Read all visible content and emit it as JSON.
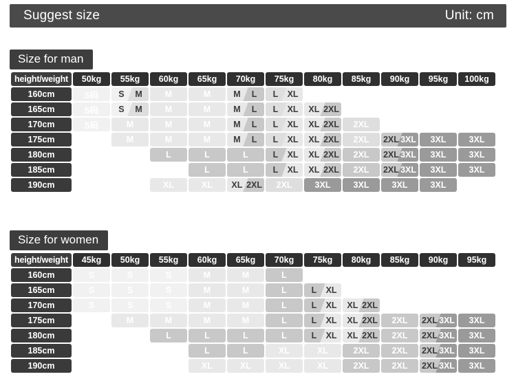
{
  "banner": {
    "title": "Suggest size",
    "unit": "Unit: cm"
  },
  "men": {
    "tab_label": "Size for man",
    "corner_label": "height/weight",
    "weights": [
      "50kg",
      "55kg",
      "60kg",
      "65kg",
      "70kg",
      "75kg",
      "80kg",
      "85kg",
      "90kg",
      "95kg",
      "100kg"
    ],
    "heights": [
      "160cm",
      "165cm",
      "170cm",
      "175cm",
      "180cm",
      "185cm",
      "190cm"
    ],
    "rows": [
      [
        {
          "t": "S码",
          "tone": 1
        },
        {
          "t": "S",
          "t2": "M",
          "tone": 1,
          "tone2": 3
        },
        {
          "t": "M",
          "tone": 2
        },
        {
          "t": "M",
          "tone": 2
        },
        {
          "t": "M",
          "t2": "L",
          "tone": 2,
          "tone2": 4
        },
        {
          "t": "L",
          "t2": "XL",
          "tone": 3,
          "tone2": 2
        },
        {
          "t": "",
          "tone": 0
        },
        {
          "t": "",
          "tone": 0
        },
        {
          "t": "",
          "tone": 0
        },
        {
          "t": "",
          "tone": 0
        },
        {
          "t": "",
          "tone": 0
        }
      ],
      [
        {
          "t": "S码",
          "tone": 1
        },
        {
          "t": "S",
          "t2": "M",
          "tone": 1,
          "tone2": 3
        },
        {
          "t": "M",
          "tone": 2
        },
        {
          "t": "M",
          "tone": 2
        },
        {
          "t": "M",
          "t2": "L",
          "tone": 2,
          "tone2": 4
        },
        {
          "t": "L",
          "t2": "XL",
          "tone": 3,
          "tone2": 2
        },
        {
          "t": "XL",
          "t2": "2XL",
          "tone": 2,
          "tone2": 4
        },
        {
          "t": "",
          "tone": 0
        },
        {
          "t": "",
          "tone": 0
        },
        {
          "t": "",
          "tone": 0
        },
        {
          "t": "",
          "tone": 0
        }
      ],
      [
        {
          "t": "S码",
          "tone": 1
        },
        {
          "t": "M",
          "tone": 2
        },
        {
          "t": "M",
          "tone": 2
        },
        {
          "t": "M",
          "tone": 2
        },
        {
          "t": "M",
          "t2": "L",
          "tone": 2,
          "tone2": 4
        },
        {
          "t": "L",
          "t2": "XL",
          "tone": 3,
          "tone2": 2
        },
        {
          "t": "XL",
          "t2": "2XL",
          "tone": 2,
          "tone2": 4
        },
        {
          "t": "2XL",
          "tone": 3
        },
        {
          "t": "",
          "tone": 0
        },
        {
          "t": "",
          "tone": 0
        },
        {
          "t": "",
          "tone": 0
        }
      ],
      [
        {
          "t": "",
          "tone": 0
        },
        {
          "t": "M",
          "tone": 2
        },
        {
          "t": "M",
          "tone": 2
        },
        {
          "t": "M",
          "tone": 2
        },
        {
          "t": "M",
          "t2": "L",
          "tone": 2,
          "tone2": 4
        },
        {
          "t": "L",
          "t2": "XL",
          "tone": 3,
          "tone2": 2
        },
        {
          "t": "XL",
          "t2": "2XL",
          "tone": 2,
          "tone2": 4
        },
        {
          "t": "2XL",
          "tone": 3
        },
        {
          "t": "2XL",
          "t2": "3XL",
          "tone": 4,
          "tone2": 6
        },
        {
          "t": "3XL",
          "tone": 6
        },
        {
          "t": "3XL",
          "tone": 6
        }
      ],
      [
        {
          "t": "",
          "tone": 0
        },
        {
          "t": "",
          "tone": 0
        },
        {
          "t": "L",
          "tone": 4
        },
        {
          "t": "L",
          "tone": 4
        },
        {
          "t": "L",
          "tone": 4
        },
        {
          "t": "L",
          "t2": "XL",
          "tone": 4,
          "tone2": 2
        },
        {
          "t": "XL",
          "t2": "2XL",
          "tone": 2,
          "tone2": 4
        },
        {
          "t": "2XL",
          "tone": 4
        },
        {
          "t": "2XL",
          "t2": "3XL",
          "tone": 4,
          "tone2": 6
        },
        {
          "t": "3XL",
          "tone": 6
        },
        {
          "t": "3XL",
          "tone": 6
        }
      ],
      [
        {
          "t": "",
          "tone": 0
        },
        {
          "t": "",
          "tone": 0
        },
        {
          "t": "",
          "tone": 0
        },
        {
          "t": "L",
          "tone": 4
        },
        {
          "t": "L",
          "tone": 4
        },
        {
          "t": "L",
          "t2": "XL",
          "tone": 4,
          "tone2": 2
        },
        {
          "t": "XL",
          "t2": "2XL",
          "tone": 2,
          "tone2": 4
        },
        {
          "t": "2XL",
          "tone": 4
        },
        {
          "t": "2XL",
          "t2": "3XL",
          "tone": 4,
          "tone2": 6
        },
        {
          "t": "3XL",
          "tone": 6
        },
        {
          "t": "3XL",
          "tone": 6
        }
      ],
      [
        {
          "t": "",
          "tone": 0
        },
        {
          "t": "",
          "tone": 0
        },
        {
          "t": "XL",
          "tone": 2
        },
        {
          "t": "XL",
          "tone": 2
        },
        {
          "t": "XL",
          "t2": "2XL",
          "tone": 2,
          "tone2": 4
        },
        {
          "t": "2XL",
          "tone": 3
        },
        {
          "t": "3XL",
          "tone": 6
        },
        {
          "t": "3XL",
          "tone": 6
        },
        {
          "t": "3XL",
          "tone": 6
        },
        {
          "t": "3XL",
          "tone": 6
        },
        {
          "t": "",
          "tone": 0
        }
      ]
    ]
  },
  "women": {
    "tab_label": "Size for women",
    "corner_label": "height/weight",
    "weights": [
      "45kg",
      "50kg",
      "55kg",
      "60kg",
      "65kg",
      "70kg",
      "75kg",
      "80kg",
      "85kg",
      "90kg",
      "95kg"
    ],
    "heights": [
      "160cm",
      "165cm",
      "170cm",
      "175cm",
      "180cm",
      "185cm",
      "190cm"
    ],
    "rows": [
      [
        {
          "t": "S",
          "tone": 1
        },
        {
          "t": "S",
          "tone": 1
        },
        {
          "t": "S",
          "tone": 1
        },
        {
          "t": "M",
          "tone": 2
        },
        {
          "t": "M",
          "tone": 2
        },
        {
          "t": "L",
          "tone": 4
        },
        {
          "t": "",
          "tone": 0
        },
        {
          "t": "",
          "tone": 0
        },
        {
          "t": "",
          "tone": 0
        },
        {
          "t": "",
          "tone": 0
        },
        {
          "t": "",
          "tone": 0
        }
      ],
      [
        {
          "t": "S",
          "tone": 1
        },
        {
          "t": "S",
          "tone": 1
        },
        {
          "t": "S",
          "tone": 1
        },
        {
          "t": "M",
          "tone": 2
        },
        {
          "t": "M",
          "tone": 2
        },
        {
          "t": "L",
          "tone": 4
        },
        {
          "t": "L",
          "t2": "XL",
          "tone": 4,
          "tone2": 2
        },
        {
          "t": "",
          "tone": 0
        },
        {
          "t": "",
          "tone": 0
        },
        {
          "t": "",
          "tone": 0
        },
        {
          "t": "",
          "tone": 0
        }
      ],
      [
        {
          "t": "S",
          "tone": 1
        },
        {
          "t": "S",
          "tone": 1
        },
        {
          "t": "S",
          "tone": 1
        },
        {
          "t": "M",
          "tone": 2
        },
        {
          "t": "M",
          "tone": 2
        },
        {
          "t": "L",
          "tone": 4
        },
        {
          "t": "L",
          "t2": "XL",
          "tone": 4,
          "tone2": 2
        },
        {
          "t": "XL",
          "t2": "2XL",
          "tone": 2,
          "tone2": 4
        },
        {
          "t": "",
          "tone": 0
        },
        {
          "t": "",
          "tone": 0
        },
        {
          "t": "",
          "tone": 0
        }
      ],
      [
        {
          "t": "",
          "tone": 0
        },
        {
          "t": "M",
          "tone": 2
        },
        {
          "t": "M",
          "tone": 2
        },
        {
          "t": "M",
          "tone": 2
        },
        {
          "t": "M",
          "tone": 2
        },
        {
          "t": "L",
          "tone": 4
        },
        {
          "t": "L",
          "t2": "XL",
          "tone": 4,
          "tone2": 2
        },
        {
          "t": "XL",
          "t2": "2XL",
          "tone": 2,
          "tone2": 4
        },
        {
          "t": "2XL",
          "tone": 4
        },
        {
          "t": "2XL",
          "t2": "3XL",
          "tone": 4,
          "tone2": 6
        },
        {
          "t": "3XL",
          "tone": 6
        }
      ],
      [
        {
          "t": "",
          "tone": 0
        },
        {
          "t": "",
          "tone": 0
        },
        {
          "t": "L",
          "tone": 4
        },
        {
          "t": "L",
          "tone": 4
        },
        {
          "t": "L",
          "tone": 4
        },
        {
          "t": "L",
          "tone": 4
        },
        {
          "t": "L",
          "t2": "XL",
          "tone": 4,
          "tone2": 2
        },
        {
          "t": "XL",
          "t2": "2XL",
          "tone": 2,
          "tone2": 4
        },
        {
          "t": "2XL",
          "tone": 4
        },
        {
          "t": "2XL",
          "t2": "3XL",
          "tone": 4,
          "tone2": 6
        },
        {
          "t": "3XL",
          "tone": 6
        }
      ],
      [
        {
          "t": "",
          "tone": 0
        },
        {
          "t": "",
          "tone": 0
        },
        {
          "t": "",
          "tone": 0
        },
        {
          "t": "L",
          "tone": 4
        },
        {
          "t": "L",
          "tone": 4
        },
        {
          "t": "XL",
          "tone": 2
        },
        {
          "t": "XL",
          "tone": 2
        },
        {
          "t": "2XL",
          "tone": 4
        },
        {
          "t": "2XL",
          "tone": 4
        },
        {
          "t": "2XL",
          "t2": "3XL",
          "tone": 4,
          "tone2": 6
        },
        {
          "t": "3XL",
          "tone": 6
        }
      ],
      [
        {
          "t": "",
          "tone": 0
        },
        {
          "t": "",
          "tone": 0
        },
        {
          "t": "",
          "tone": 0
        },
        {
          "t": "XL",
          "tone": 2
        },
        {
          "t": "XL",
          "tone": 2
        },
        {
          "t": "XL",
          "tone": 2
        },
        {
          "t": "XL",
          "tone": 2
        },
        {
          "t": "2XL",
          "tone": 4
        },
        {
          "t": "2XL",
          "tone": 4
        },
        {
          "t": "2XL",
          "t2": "3XL",
          "tone": 4,
          "tone2": 6
        },
        {
          "t": "3XL",
          "tone": 6
        }
      ]
    ]
  },
  "colors": {
    "banner_bg": "#4a4a4a",
    "header_bg": "#303030",
    "rowhead_bg": "#3a3a3a",
    "tab_bg": "#3d3d3d",
    "tone1": "#f1f1f1",
    "tone2": "#e8e8e8",
    "tone3": "#dedede",
    "tone4": "#c8c8c8",
    "tone5": "#b4b4b4",
    "tone6": "#9a9a9a"
  }
}
